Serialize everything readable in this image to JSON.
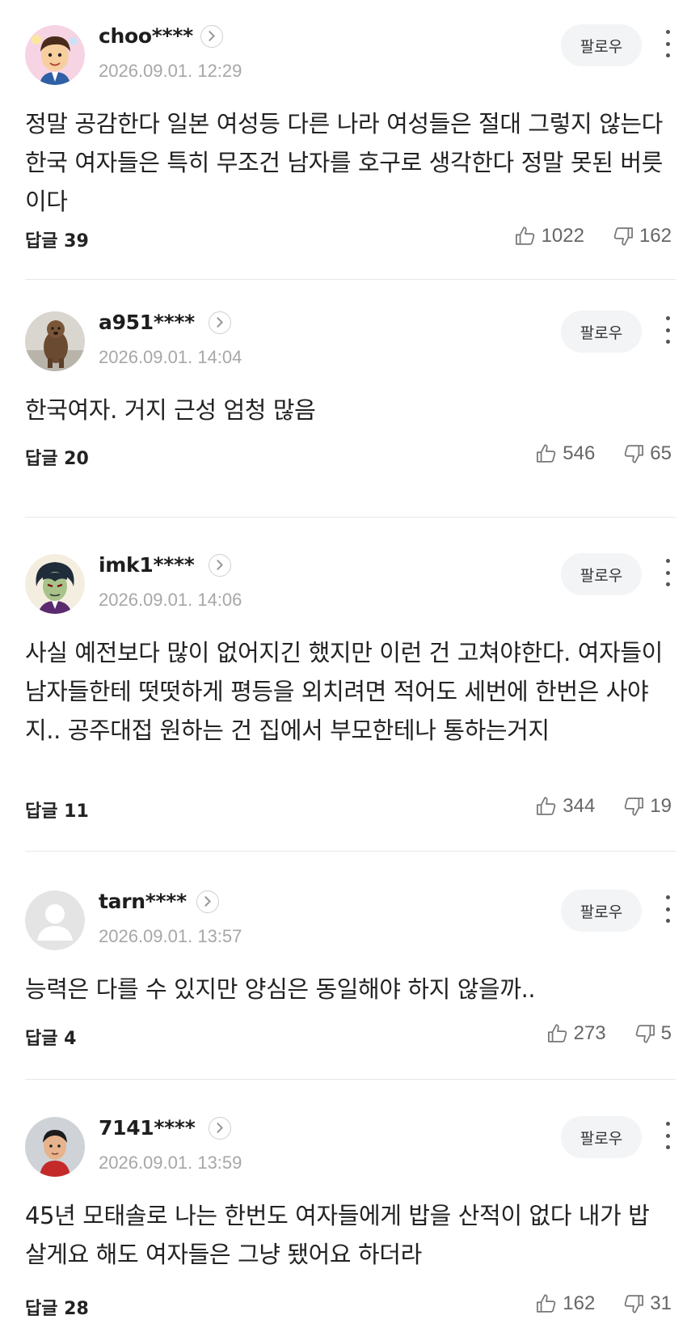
{
  "follow_label": "팔로우",
  "reply_label": "답글",
  "comments": [
    {
      "user": "choo****",
      "date": "2026.09.01. 12:29",
      "text": "정말 공감한다 일본 여성등 다른 나라 여성들은 절대 그렇지 않는다 한국 여자들은 특히 무조건 남자를 호구로 생각한다 정말 못된 버릇이다",
      "replies": "39",
      "likes": "1022",
      "dislikes": "162",
      "avatar": "cartoon-man-avatar"
    },
    {
      "user": "a951****",
      "date": "2026.09.01. 14:04",
      "text": "한국여자. 거지 근성 엄청 많음",
      "replies": "20",
      "likes": "546",
      "dislikes": "65",
      "avatar": "dog-photo-avatar"
    },
    {
      "user": "imk1****",
      "date": "2026.09.01. 14:06",
      "text": "사실 예전보다 많이 없어지긴 했지만 이런 건 고쳐야한다. 여자들이 남자들한테 떳떳하게 평등을 외치려면 적어도 세번에 한번은 사야지.. 공주대접 원하는 건 집에서 부모한테나 통하는거지",
      "replies": "11",
      "likes": "344",
      "dislikes": "19",
      "avatar": "anime-character-avatar"
    },
    {
      "user": "tarn****",
      "date": "2026.09.01. 13:57",
      "text": "능력은 다를 수 있지만 양심은 동일해야 하지 않을까..",
      "replies": "4",
      "likes": "273",
      "dislikes": "5",
      "avatar": "default-person-avatar"
    },
    {
      "user": "7141****",
      "date": "2026.09.01. 13:59",
      "text": "45년 모태솔로 나는 한번도 여자들에게 밥을 산적이 없다 내가 밥 살게요 해도 여자들은 그냥 됐어요 하더라",
      "replies": "28",
      "likes": "162",
      "dislikes": "31",
      "avatar": "person-photo-avatar"
    }
  ]
}
